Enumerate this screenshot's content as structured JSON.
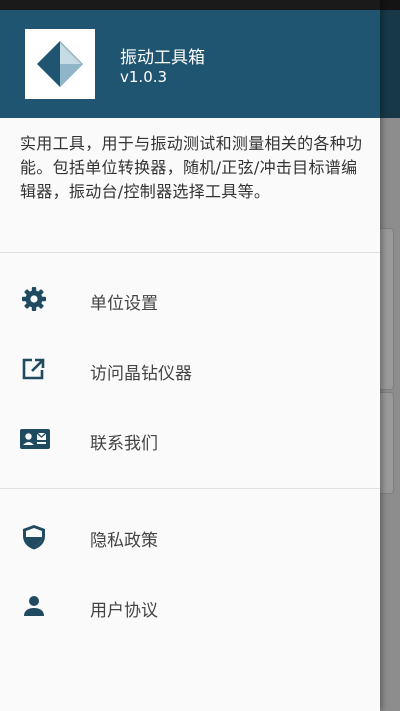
{
  "theme": {
    "header_bg": "#1f5570",
    "icon_color": "#1f4a60",
    "drawer_bg": "#fafafa"
  },
  "drawer": {
    "logo_icon": "diamond-logo-icon",
    "app_title": "振动工具箱",
    "app_version": "v1.0.3",
    "description": "实用工具，用于与振动测试和测量相关的各种功能。包括单位转换器，随机/正弦/冲击目标谱编辑器，振动台/控制器选择工具等。",
    "menu_group_1": [
      {
        "label": "单位设置",
        "icon": "gear-icon"
      },
      {
        "label": "访问晶钻仪器",
        "icon": "open-in-new-icon"
      },
      {
        "label": "联系我们",
        "icon": "contact-card-icon"
      }
    ],
    "menu_group_2": [
      {
        "label": "隐私政策",
        "icon": "shield-icon"
      },
      {
        "label": "用户协议",
        "icon": "person-icon"
      }
    ]
  }
}
